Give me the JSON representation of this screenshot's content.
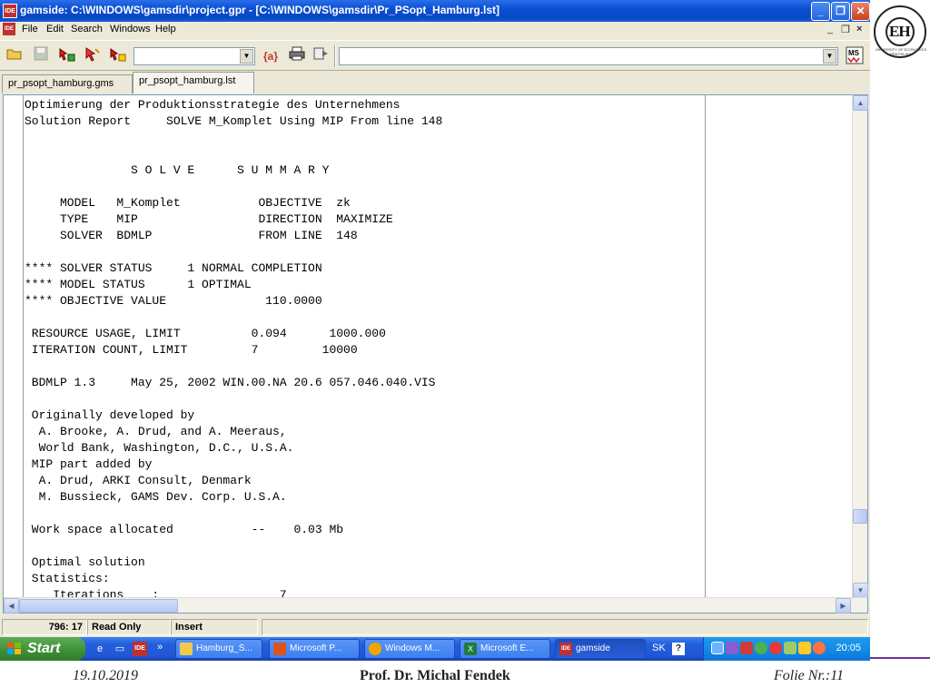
{
  "window": {
    "title": "gamside: C:\\WINDOWS\\gamsdir\\project.gpr - [C:\\WINDOWS\\gamsdir\\Pr_PSopt_Hamburg.lst]",
    "app_icon_text": "IDE",
    "minimize": "_",
    "restore": "❐",
    "close": "✕"
  },
  "menu": {
    "items": [
      "File",
      "Edit",
      "Search",
      "Windows",
      "Help"
    ],
    "mdi_minimize": "_",
    "mdi_restore": "❐",
    "mdi_close": "×"
  },
  "toolbar": {
    "combo1_value": "",
    "combo2_value": "",
    "icons": [
      "open-folder-icon",
      "save-disk-icon",
      "run-icon",
      "mark-icon",
      "model-icon",
      "find-icon",
      "print-icon",
      "next-icon",
      "ms-icon"
    ]
  },
  "tabs": [
    {
      "label": "pr_psopt_hamburg.gms",
      "active": false
    },
    {
      "label": "pr_psopt_hamburg.lst",
      "active": true
    }
  ],
  "listing": [
    "Optimierung der Produktionsstrategie des Unternehmens",
    "Solution Report     SOLVE M_Komplet Using MIP From line 148",
    "",
    "",
    "               S O L V E      S U M M A R Y",
    "",
    "     MODEL   M_Komplet           OBJECTIVE  zk",
    "     TYPE    MIP                 DIRECTION  MAXIMIZE",
    "     SOLVER  BDMLP               FROM LINE  148",
    "",
    "**** SOLVER STATUS     1 NORMAL COMPLETION",
    "**** MODEL STATUS      1 OPTIMAL",
    "**** OBJECTIVE VALUE              110.0000",
    "",
    " RESOURCE USAGE, LIMIT          0.094      1000.000",
    " ITERATION COUNT, LIMIT         7         10000",
    "",
    " BDMLP 1.3     May 25, 2002 WIN.00.NA 20.6 057.046.040.VIS",
    "",
    " Originally developed by",
    "  A. Brooke, A. Drud, and A. Meeraus,",
    "  World Bank, Washington, D.C., U.S.A.",
    " MIP part added by",
    "  A. Drud, ARKI Consult, Denmark",
    "  M. Bussieck, GAMS Dev. Corp. U.S.A.",
    "",
    " Work space allocated           --    0.03 Mb",
    "",
    " Optimal solution",
    " Statistics:",
    "    Iterations    :                 7"
  ],
  "status": {
    "position": "796: 17",
    "mode": "Read Only",
    "insert": "Insert"
  },
  "taskbar": {
    "start_label": "Start",
    "chevron": "»",
    "buttons": [
      {
        "label": "Hamburg_S...",
        "icon": "folder-icon",
        "color": "#f2c94c"
      },
      {
        "label": "Microsoft P...",
        "icon": "powerpoint-icon",
        "color": "#d9541e"
      },
      {
        "label": "Windows M...",
        "icon": "media-player-icon",
        "color": "#f4a300"
      },
      {
        "label": "Microsoft E...",
        "icon": "excel-icon",
        "color": "#1f7a3c"
      },
      {
        "label": "gamside",
        "icon": "gamside-icon",
        "color": "#c03030",
        "active": true
      }
    ],
    "language": "SK",
    "clock": "20:05"
  },
  "slide": {
    "logo_letters": "EH",
    "logo_caption": "UNIVERSITY OF ECONOMICS BRATISLAVA",
    "date": "19.10.2019",
    "author": "Prof. Dr. Michal Fendek",
    "slide_label": "Folie Nr.:11"
  },
  "colors": {
    "titlebar": "#0a4fd4",
    "start_button": "#3c8f34",
    "taskbar": "#245edb",
    "footer_rule": "#7030a0"
  }
}
